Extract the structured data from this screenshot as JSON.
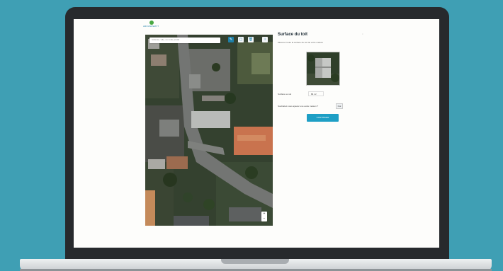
{
  "colors": {
    "background": "#3f9fb4",
    "accent": "#1e9fc5",
    "logo_green": "#48a843"
  },
  "logo": {
    "text": "AROUNDWATT"
  },
  "map": {
    "search_placeholder": "Adresse, ville, ou code postal",
    "tools": [
      {
        "name": "pencil-icon",
        "glyph": "✎"
      },
      {
        "name": "square-icon",
        "glyph": "▢"
      },
      {
        "name": "trash-icon",
        "glyph": "🗑"
      },
      {
        "name": "info-icon",
        "glyph": "i"
      }
    ],
    "zoom_in": "+",
    "zoom_out": "−"
  },
  "panel": {
    "title": "Surface du toit",
    "close_label": "×",
    "description": "Mesurez toute la surface du toit de votre maison",
    "surface_label": "Surface au sol",
    "surface_value": "84 m²",
    "question": "Souhaitez-vous ajouter une autre maison ?",
    "toggle_label": "Oui",
    "continue_label": "CONTINUER"
  }
}
